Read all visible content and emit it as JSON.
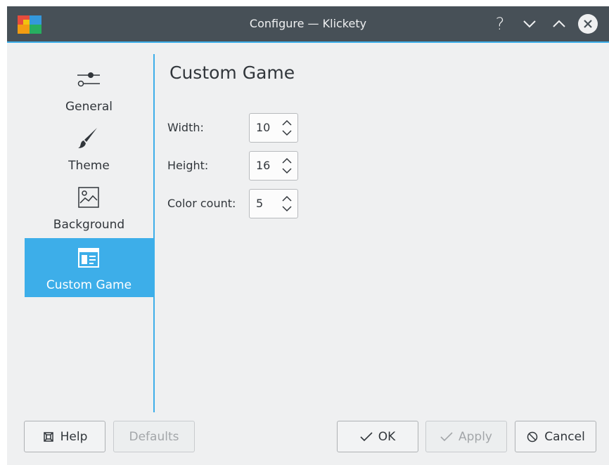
{
  "window": {
    "title": "Configure — Klickety"
  },
  "titlebar": {
    "help_icon": "question-mark-icon",
    "minimize_icon": "chevron-down-icon",
    "maximize_icon": "chevron-up-icon",
    "close_icon": "close-circle-icon",
    "help_glyph": "?"
  },
  "sidebar": {
    "items": [
      {
        "label": "General",
        "icon": "sliders-icon"
      },
      {
        "label": "Theme",
        "icon": "paintbrush-icon"
      },
      {
        "label": "Background",
        "icon": "image-icon"
      },
      {
        "label": "Custom Game",
        "icon": "window-layout-icon",
        "selected": true
      }
    ]
  },
  "main": {
    "title": "Custom Game",
    "fields": [
      {
        "label": "Width:",
        "value": "10"
      },
      {
        "label": "Height:",
        "value": "16"
      },
      {
        "label": "Color count:",
        "value": "5"
      }
    ]
  },
  "buttons": {
    "help": "Help",
    "defaults": "Defaults",
    "ok": "OK",
    "apply": "Apply",
    "cancel": "Cancel"
  },
  "colors": {
    "accent": "#3daee9",
    "titlebar": "#475057",
    "window_bg": "#eff0f1",
    "text": "#31363b"
  }
}
